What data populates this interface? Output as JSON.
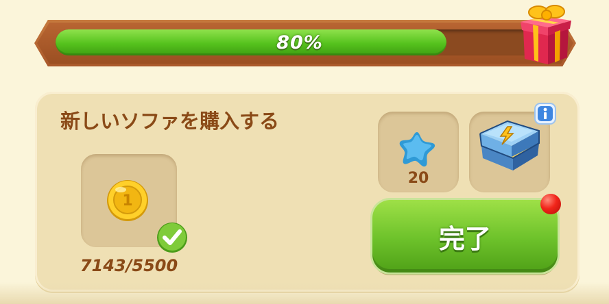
{
  "progress": {
    "label": "80%",
    "value": 0.8
  },
  "quest": {
    "title": "新しいソファを購入する"
  },
  "requirement": {
    "item": "coin-icon",
    "count": "7143/5500",
    "completed": true
  },
  "rewards": [
    {
      "icon": "star-icon",
      "value": "20"
    },
    {
      "icon": "chest-icon"
    }
  ],
  "done_button": {
    "label": "完了"
  },
  "colors": {
    "background": "#fbf5da",
    "panel": "#efe0b4",
    "text_brown": "#8a4a17",
    "progress_green": "#55c21d",
    "button_green": "#6cc12a",
    "alert_red": "#f1251a",
    "info_blue": "#3f86e0"
  }
}
